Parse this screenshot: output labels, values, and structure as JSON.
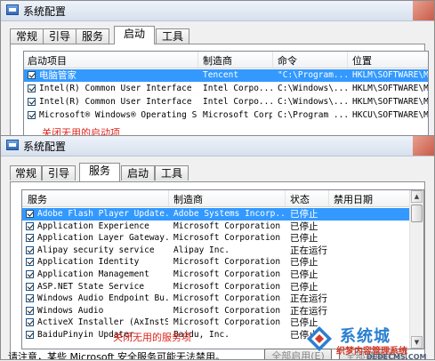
{
  "window_top": {
    "title": "系统配置",
    "tabs": [
      "常规",
      "引导",
      "服务",
      "启动",
      "工具"
    ],
    "active_tab": "启动",
    "columns": [
      "启动项目",
      "制造商",
      "命令",
      "位置"
    ],
    "rows": [
      {
        "item": "电脑管家",
        "maker": "Tencent",
        "cmd": "\"C:\\Program...",
        "loc": "HKLM\\SOFTWARE\\M",
        "selected": true
      },
      {
        "item": "Intel(R) Common User Interface",
        "maker": "Intel Corpo...",
        "cmd": "C:\\Windows\\...",
        "loc": "HKLM\\SOFTWARE\\M",
        "selected": false
      },
      {
        "item": "Intel(R) Common User Interface",
        "maker": "Intel Corpo...",
        "cmd": "C:\\Windows\\...",
        "loc": "HKLM\\SOFTWARE\\M",
        "selected": false
      },
      {
        "item": "Microsoft® Windows® Operating S...",
        "maker": "Microsoft Corpo...",
        "cmd": "C:\\Program ...",
        "loc": "HKCU\\SOFTWARE\\M",
        "selected": false
      }
    ],
    "annotation": "关闭无用的启动项"
  },
  "window_bottom": {
    "title": "系统配置",
    "tabs": [
      "常规",
      "引导",
      "服务",
      "启动",
      "工具"
    ],
    "active_tab": "服务",
    "columns": [
      "服务",
      "制造商",
      "状态",
      "禁用日期"
    ],
    "rows": [
      {
        "name": "Adobe Flash Player Update...",
        "maker": "Adobe Systems Incorp...",
        "status": "已停止",
        "selected": true
      },
      {
        "name": "Application Experience",
        "maker": "Microsoft Corporation",
        "status": "已停止",
        "selected": false
      },
      {
        "name": "Application Layer Gateway...",
        "maker": "Microsoft Corporation",
        "status": "已停止",
        "selected": false
      },
      {
        "name": "Alipay security service",
        "maker": "Alipay Inc.",
        "status": "正在运行",
        "selected": false
      },
      {
        "name": "Application Identity",
        "maker": "Microsoft Corporation",
        "status": "已停止",
        "selected": false
      },
      {
        "name": "Application Management",
        "maker": "Microsoft Corporation",
        "status": "已停止",
        "selected": false
      },
      {
        "name": "ASP.NET State Service",
        "maker": "Microsoft Corporation",
        "status": "已停止",
        "selected": false
      },
      {
        "name": "Windows Audio Endpoint Bu...",
        "maker": "Microsoft Corporation",
        "status": "正在运行",
        "selected": false
      },
      {
        "name": "Windows Audio",
        "maker": "Microsoft Corporation",
        "status": "正在运行",
        "selected": false
      },
      {
        "name": "ActiveX Installer (AxInstSV)",
        "maker": "Microsoft Corporation",
        "status": "已停止",
        "selected": false
      },
      {
        "name": "BaiduPinyin Updater",
        "maker": "Baidu, Inc.",
        "status": "已停止",
        "selected": false
      }
    ],
    "annotation": "关闭无用的服务项",
    "note": "请注意，某些 Microsoft 安全服务可能无法禁用。",
    "buttons": [
      "全部启用(E)",
      "全部禁用(D)"
    ]
  },
  "watermark": {
    "title": "系统城",
    "subtitle": "织梦内容管理系统",
    "url": "DEDECMS.COM"
  },
  "colors": {
    "selection": "#3399ff",
    "annotation": "#e0241c",
    "watermark_blue": "#2a7fd0"
  },
  "icons": [
    "system-config-icon",
    "checkbox-checked-icon",
    "scroll-up-icon",
    "scroll-down-icon",
    "watermark-logo-icon"
  ]
}
